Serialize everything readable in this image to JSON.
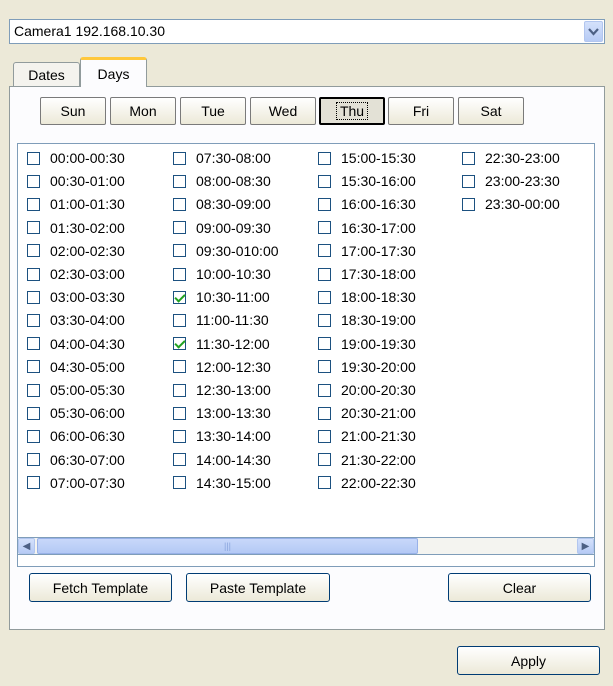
{
  "camera_select": {
    "value": "Camera1 192.168.10.30"
  },
  "tabs": [
    {
      "label": "Dates",
      "active": false
    },
    {
      "label": "Days",
      "active": true
    }
  ],
  "weekdays": [
    "Sun",
    "Mon",
    "Tue",
    "Wed",
    "Thu",
    "Fri",
    "Sat"
  ],
  "selected_weekday": "Thu",
  "time_slots": [
    [
      "00:00-00:30",
      "00:30-01:00",
      "01:00-01:30",
      "01:30-02:00",
      "02:00-02:30",
      "02:30-03:00",
      "03:00-03:30",
      "03:30-04:00",
      "04:00-04:30",
      "04:30-05:00",
      "05:00-05:30",
      "05:30-06:00",
      "06:00-06:30",
      "06:30-07:00",
      "07:00-07:30"
    ],
    [
      "07:30-08:00",
      "08:00-08:30",
      "08:30-09:00",
      "09:00-09:30",
      "09:30-010:00",
      "10:00-10:30",
      "10:30-11:00",
      "11:00-11:30",
      "11:30-12:00",
      "12:00-12:30",
      "12:30-13:00",
      "13:00-13:30",
      "13:30-14:00",
      "14:00-14:30",
      "14:30-15:00"
    ],
    [
      "15:00-15:30",
      "15:30-16:00",
      "16:00-16:30",
      "16:30-17:00",
      "17:00-17:30",
      "17:30-18:00",
      "18:00-18:30",
      "18:30-19:00",
      "19:00-19:30",
      "19:30-20:00",
      "20:00-20:30",
      "20:30-21:00",
      "21:00-21:30",
      "21:30-22:00",
      "22:00-22:30"
    ],
    [
      "22:30-23:00",
      "23:00-23:30",
      "23:30-00:00"
    ]
  ],
  "checked_slots": [
    "10:30-11:00",
    "11:30-12:00"
  ],
  "buttons": {
    "fetch_template": "Fetch Template",
    "paste_template": "Paste Template",
    "clear": "Clear",
    "apply": "Apply"
  },
  "icons": {
    "dropdown": "chevron-down-icon",
    "scroll_left": "arrow-left-icon",
    "scroll_right": "arrow-right-icon"
  }
}
